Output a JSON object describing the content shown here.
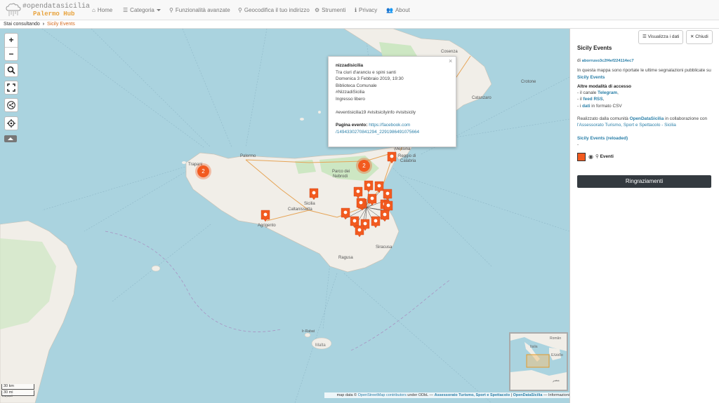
{
  "brand": {
    "title": "#opendatasicilia",
    "subtitle": "Palermo Hub"
  },
  "nav": [
    {
      "label": "Home",
      "icon": "home-icon"
    },
    {
      "label": "Categoria",
      "icon": "list-icon"
    },
    {
      "label": "Funzionalità avanzate",
      "icon": "search-icon"
    },
    {
      "label": "Geocodifica il tuo indirizzo",
      "icon": "map-marker-icon"
    },
    {
      "label": "Strumenti",
      "icon": "gear-icon"
    },
    {
      "label": "Privacy",
      "icon": "info-icon"
    },
    {
      "label": "About",
      "icon": "users-icon"
    }
  ],
  "breadcrumb": {
    "prefix": "Stai consultando",
    "current": "Sicily Events"
  },
  "map": {
    "places": [
      "Palermo",
      "Trapani",
      "Sicilia",
      "Caltanissetta",
      "Agrigento",
      "Siracusa",
      "Ragusa",
      "Messina",
      "Reggio di Calabria",
      "Cosenza",
      "Catanzaro",
      "Crotone",
      "Parco dei Nebrodi",
      "Malta",
      "Ir-Rabat",
      "Ghadames"
    ],
    "clusters": [
      "2",
      "2"
    ],
    "marker_color": "#f25a1f"
  },
  "popup": {
    "title": "nizzadisicilia",
    "lines": [
      "Tra ciuri d'aranciu e spini santi",
      "Domenica 3 Febbraio 2019, 19:30",
      "Biblioteca Comunale",
      "#NizzadiSicilia",
      "Ingresso libero"
    ],
    "tags": "#eventisicilia19 #visitsicilyinfo #visitsicily",
    "link_label": "Pagina evento:",
    "link_line1": "https://facebook.com",
    "link_line2": "/149433027084129​4_2291986491075664"
  },
  "scale": {
    "km": "30 km",
    "mi": "30 mi"
  },
  "attribution": {
    "prefix": "map data ©",
    "osm": "OpenStreetMap contributors",
    "odbl": "under ODbL —",
    "assessorato": "Assessorato Turismo, Sport e Spettacolo",
    "sep": "|",
    "ods": "OpenDataSicilia",
    "info": "— Informazioni"
  },
  "sidebar": {
    "view_data_label": "Visualizza i dati",
    "close_label": "Chiudi",
    "title": "Sicily Events",
    "by_prefix": "di",
    "author": "aborruso3c2f4ef224114ec7",
    "intro_text": "In questa mappa sono riportate le ultime segnalazioni pubblicate su",
    "intro_link": "Sicily Events",
    "access_heading": "Altre modalità di accesso",
    "access_items": [
      {
        "pre": "- il canale ",
        "link": "Telegram",
        "post": ","
      },
      {
        "pre": "- il ",
        "link": "feed RSS",
        "post": ","
      },
      {
        "pre": "- i ",
        "link": "dati",
        "post": " in formato CSV"
      }
    ],
    "credit_pre": "Realizzato dalla comunità",
    "credit_link": "OpenDataSicilia",
    "credit_mid": "in collaborazione con",
    "credit_line2": "l'Assessorato Turismo, Sport e Spettacolo - Sicilia",
    "reloaded_link": "Sicily Events (reloaded)",
    "reloaded_dash": "-",
    "layer_label": "Eventi",
    "layer_color": "#f25a1f",
    "thanks_label": "Ringraziamenti"
  },
  "minimap": {
    "labels": [
      "Italia",
      "Român",
      "Ελλάδα",
      "مصر"
    ]
  }
}
